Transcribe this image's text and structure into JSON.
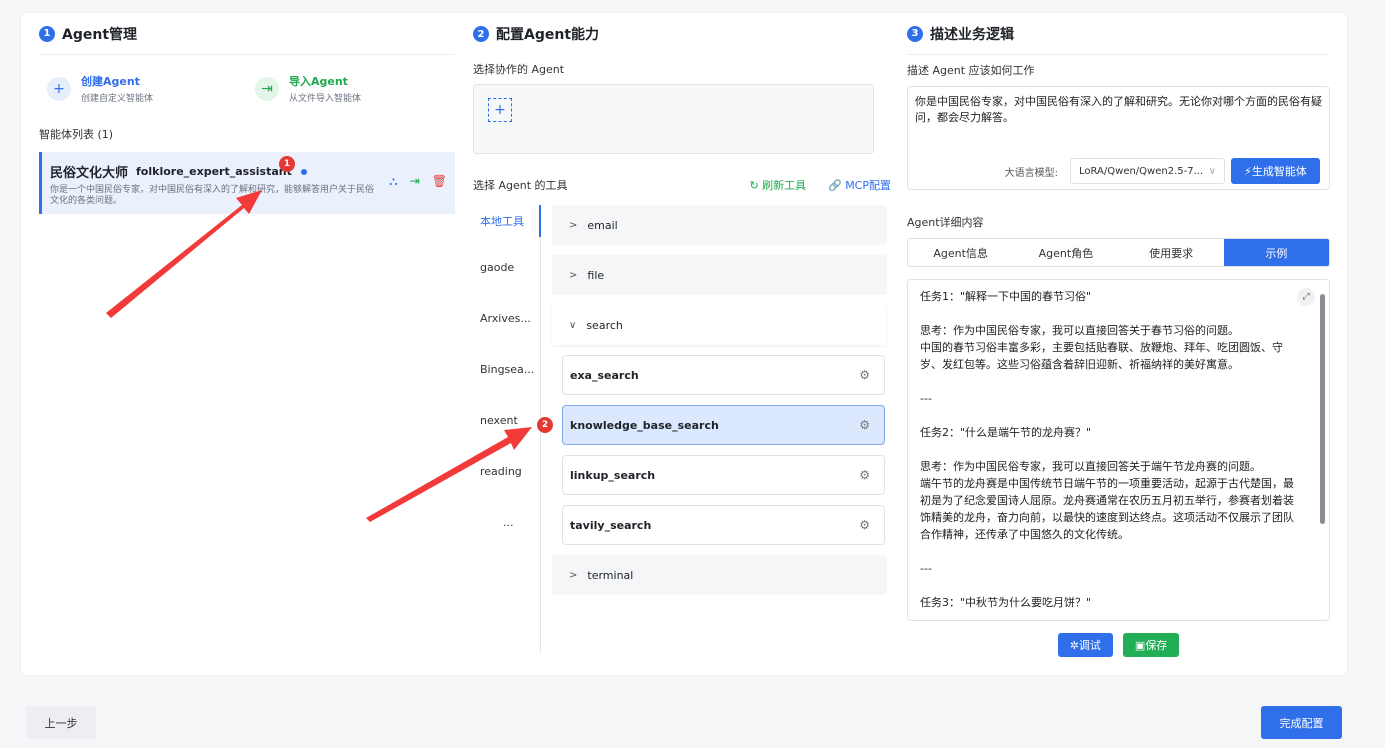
{
  "section1": {
    "num": "1",
    "title": "Agent管理",
    "create": {
      "title": "创建Agent",
      "desc": "创建自定义智能体"
    },
    "import": {
      "title": "导入Agent",
      "desc": "从文件导入智能体"
    },
    "list_label": "智能体列表 (1)",
    "agent": {
      "cn_name": "民俗文化大师",
      "en_name": "folklore_expert_assistant",
      "desc": "你是一个中国民俗专家，对中国民俗有深入的了解和研究，能够解答用户关于民俗文化的各类问题。"
    }
  },
  "section2": {
    "num": "2",
    "title": "配置Agent能力",
    "collab_label": "选择协作的 Agent",
    "tools_label": "选择 Agent 的工具",
    "refresh": "刷新工具",
    "mcp": "MCP配置",
    "tabs": [
      "本地工具",
      "gaode",
      "Arxives...",
      "Bingsea...",
      "nexent",
      "reading",
      "..."
    ],
    "groups": {
      "email": "email",
      "file": "file",
      "search": "search",
      "terminal": "terminal"
    },
    "search_tools": [
      "exa_search",
      "knowledge_base_search",
      "linkup_search",
      "tavily_search"
    ]
  },
  "section3": {
    "num": "3",
    "title": "描述业务逻辑",
    "desc_label": "描述 Agent 应该如何工作",
    "desc_text": "你是中国民俗专家，对中国民俗有深入的了解和研究。无论你对哪个方面的民俗有疑问，都会尽力解答。",
    "model_label": "大语言模型:",
    "model_value": "LoRA/Qwen/Qwen2.5-7...",
    "gen_button": "生成智能体",
    "detail_label": "Agent详细内容",
    "tabs": [
      "Agent信息",
      "Agent角色",
      "使用要求",
      "示例"
    ],
    "example": [
      "任务1：\"解释一下中国的春节习俗\"",
      "思考：作为中国民俗专家，我可以直接回答关于春节习俗的问题。\n中国的春节习俗丰富多彩，主要包括贴春联、放鞭炮、拜年、吃团圆饭、守岁、发红包等。这些习俗蕴含着辞旧迎新、祈福纳祥的美好寓意。",
      "---",
      "任务2：\"什么是端午节的龙舟赛？\"",
      "思考：作为中国民俗专家，我可以直接回答关于端午节龙舟赛的问题。\n端午节的龙舟赛是中国传统节日端午节的一项重要活动，起源于古代楚国，最初是为了纪念爱国诗人屈原。龙舟赛通常在农历五月初五举行，参赛者划着装饰精美的龙舟，奋力向前，以最快的速度到达终点。这项活动不仅展示了团队合作精神，还传承了中国悠久的文化传统。",
      "---",
      "任务3：\"中秋节为什么要吃月饼？\""
    ],
    "debug_button": "调试",
    "save_button": "保存"
  },
  "footer": {
    "prev": "上一步",
    "finish": "完成配置"
  },
  "badges": [
    "1",
    "2"
  ]
}
